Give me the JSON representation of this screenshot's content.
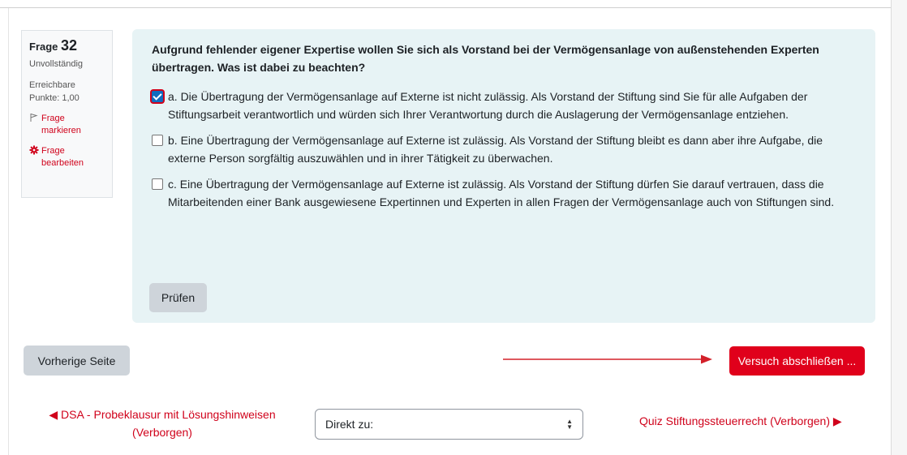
{
  "question_info": {
    "label": "Frage",
    "number": "32",
    "state": "Unvollständig",
    "grade": "Erreichbare Punkte: 1,00",
    "flag_label": "Frage markieren",
    "edit_label": "Frage bearbeiten"
  },
  "question": {
    "text": "Aufgrund fehlender eigener Expertise wollen Sie sich als Vorstand bei der Vermögensanlage von außenstehenden Experten übertragen. Was ist dabei zu beachten?",
    "answers": [
      {
        "text": "a. Die Übertragung der Vermögensanlage auf Externe ist nicht zulässig. Als Vorstand der Stiftung sind Sie für alle Aufgaben der Stiftungsarbeit verantwortlich und würden sich Ihrer Verantwortung durch die Auslagerung der Vermögensanlage entziehen.",
        "checked": true
      },
      {
        "text": "b. Eine Übertragung der Vermögensanlage auf Externe ist zulässig. Als Vorstand der Stiftung bleibt es dann aber ihre Aufgabe, die externe Person sorgfältig auszuwählen und in ihrer Tätigkeit zu überwachen.",
        "checked": false
      },
      {
        "text": "c. Eine Übertragung der Vermögensanlage auf Externe ist zulässig. Als Vorstand der Stiftung dürfen Sie darauf vertrauen, dass die Mitarbeitenden einer Bank ausgewiesene Expertinnen und Experten in allen Fragen der Vermögensanlage auch von Stiftungen sind.",
        "checked": false
      }
    ],
    "check_button": "Prüfen"
  },
  "navigation": {
    "prev_page": "Vorherige Seite",
    "finish_attempt": "Versuch abschließen ...",
    "prev_activity": "◀ DSA - Probeklausur mit Lösungshinweisen (Verborgen)",
    "jump_to": "Direkt zu:",
    "next_activity": "Quiz Stiftungssteuerrecht  (Verborgen) ▶"
  },
  "colors": {
    "accent": "#e0001b",
    "link": "#d0021b",
    "content_bg": "#e7f3f5",
    "arrow": "#d3202a"
  },
  "icons": {
    "flag": "flag-icon",
    "edit": "gear-icon",
    "select_arrows": "sort-icon"
  }
}
